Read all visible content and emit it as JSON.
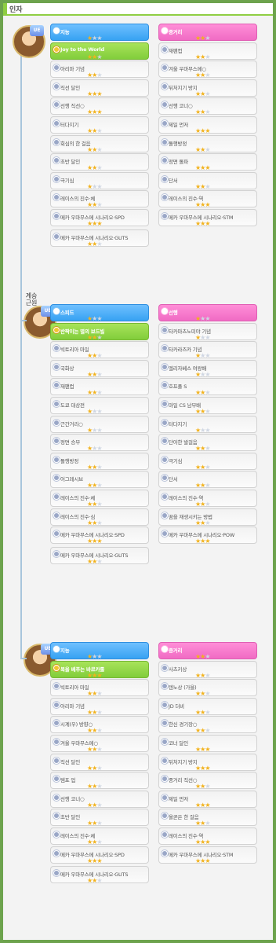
{
  "header": {
    "title": "인자"
  },
  "side_label": "계승\n근원",
  "sections": [
    {
      "badge": "UE",
      "rows": [
        {
          "left": {
            "label": "지능",
            "stars": 1,
            "style": "blue"
          },
          "right": {
            "label": "중거리",
            "stars": 2,
            "style": "pink"
          }
        },
        {
          "left": {
            "label": "Joy to the World",
            "stars": 2,
            "style": "green"
          },
          "right": {
            "label": "재팬컵",
            "stars": 2,
            "style": "white"
          }
        },
        {
          "left": {
            "label": "아리마 기념",
            "stars": 2,
            "style": "white"
          },
          "right": {
            "label": "겨울 우마무스메○",
            "stars": 2,
            "style": "white"
          }
        },
        {
          "left": {
            "label": "직선 달인",
            "stars": 3,
            "style": "white"
          },
          "right": {
            "label": "뒤처지기 방지",
            "stars": 2,
            "style": "white"
          }
        },
        {
          "left": {
            "label": "선행 직선○",
            "stars": 3,
            "style": "white"
          },
          "right": {
            "label": "선행 코너○",
            "stars": 2,
            "style": "white"
          }
        },
        {
          "left": {
            "label": "터다지기",
            "stars": 2,
            "style": "white"
          },
          "right": {
            "label": "제일 먼저",
            "stars": 3,
            "style": "white"
          }
        },
        {
          "left": {
            "label": "회심의 한 걸음",
            "stars": 2,
            "style": "white"
          },
          "right": {
            "label": "돌행방정",
            "stars": 2,
            "style": "white"
          }
        },
        {
          "left": {
            "label": "초반 달인",
            "stars": 2,
            "style": "white"
          },
          "right": {
            "label": "정면 돌파",
            "stars": 3,
            "style": "white"
          }
        },
        {
          "left": {
            "label": "극기심",
            "stars": 1,
            "style": "white"
          },
          "right": {
            "label": "단서",
            "stars": 2,
            "style": "white"
          }
        },
        {
          "left": {
            "label": "레이스의 진수·체",
            "stars": 2,
            "style": "white"
          },
          "right": {
            "label": "레이스의 진수·역",
            "stars": 3,
            "style": "white"
          }
        },
        {
          "left": {
            "label": "메카 우마무스메 시나리오·SPD",
            "stars": 3,
            "style": "white"
          },
          "right": {
            "label": "메카 우마무스메 시나리오·STM",
            "stars": 3,
            "style": "white"
          }
        },
        {
          "left": {
            "label": "메카 우마무스메 시나리오·GUTS",
            "stars": 2,
            "style": "white"
          },
          "right": null
        }
      ]
    },
    {
      "badge": "UE",
      "rows": [
        {
          "left": {
            "label": "스피드",
            "stars": 1,
            "style": "blue"
          },
          "right": {
            "label": "선행",
            "stars": 1,
            "style": "pink"
          }
        },
        {
          "left": {
            "label": "반짝이는 별의 보드빌",
            "stars": 2,
            "style": "green"
          },
          "right": {
            "label": "타카마츠노미야 기념",
            "stars": 1,
            "style": "white"
          }
        },
        {
          "left": {
            "label": "빅토리아 마일",
            "stars": 2,
            "style": "white"
          },
          "right": {
            "label": "타카라즈카 기념",
            "stars": 1,
            "style": "white"
          }
        },
        {
          "left": {
            "label": "국화상",
            "stars": 2,
            "style": "white"
          },
          "right": {
            "label": "엘리자베스 여왕배",
            "stars": 1,
            "style": "white"
          }
        },
        {
          "left": {
            "label": "재팬컵",
            "stars": 2,
            "style": "white"
          },
          "right": {
            "label": "호프풀 S",
            "stars": 2,
            "style": "white"
          }
        },
        {
          "left": {
            "label": "도쿄 대상전",
            "stars": 1,
            "style": "white"
          },
          "right": {
            "label": "마일 CS 남부배",
            "stars": 2,
            "style": "white"
          }
        },
        {
          "left": {
            "label": "근간거리○",
            "stars": 1,
            "style": "white"
          },
          "right": {
            "label": "터다지기",
            "stars": 1,
            "style": "white"
          }
        },
        {
          "left": {
            "label": "정면 승부",
            "stars": 1,
            "style": "white"
          },
          "right": {
            "label": "단아한 발걸음",
            "stars": 2,
            "style": "white"
          }
        },
        {
          "left": {
            "label": "돌행방정",
            "stars": 2,
            "style": "white"
          },
          "right": {
            "label": "극기심",
            "stars": 2,
            "style": "white"
          }
        },
        {
          "left": {
            "label": "어그레시브",
            "stars": 2,
            "style": "white"
          },
          "right": {
            "label": "단서",
            "stars": 2,
            "style": "white"
          }
        },
        {
          "left": {
            "label": "레이스의 진수·체",
            "stars": 2,
            "style": "white"
          },
          "right": {
            "label": "레이스의 진수·역",
            "stars": 2,
            "style": "white"
          }
        },
        {
          "left": {
            "label": "레이스의 진수·심",
            "stars": 2,
            "style": "white"
          },
          "right": {
            "label": "꿈을 재생시키는 방법",
            "stars": 2,
            "style": "white"
          }
        },
        {
          "left": {
            "label": "메카 우마무스메 시나리오·SPD",
            "stars": 3,
            "style": "white"
          },
          "right": {
            "label": "메카 우마무스메 시나리오·POW",
            "stars": 3,
            "style": "white"
          }
        },
        {
          "left": {
            "label": "메카 우마무스메 시나리오·GUTS",
            "stars": 2,
            "style": "white"
          },
          "right": null
        }
      ]
    },
    {
      "badge": "UE",
      "rows": [
        {
          "left": {
            "label": "지능",
            "stars": 1,
            "style": "blue"
          },
          "right": {
            "label": "중거리",
            "stars": 2,
            "style": "pink"
          }
        },
        {
          "left": {
            "label": "복을 베푸는 바르카롤",
            "stars": 3,
            "style": "green"
          },
          "right": {
            "label": "사츠키상",
            "stars": 2,
            "style": "white"
          }
        },
        {
          "left": {
            "label": "빅토리아 마일",
            "stars": 2,
            "style": "white"
          },
          "right": {
            "label": "텐노상 (가을)",
            "stars": 2,
            "style": "white"
          }
        },
        {
          "left": {
            "label": "아리마 기념",
            "stars": 2,
            "style": "white"
          },
          "right": {
            "label": "JD 더비",
            "stars": 2,
            "style": "white"
          }
        },
        {
          "left": {
            "label": "시계(우) 방향○",
            "stars": 2,
            "style": "white"
          },
          "right": {
            "label": "한신 경기장○",
            "stars": 2,
            "style": "white"
          }
        },
        {
          "left": {
            "label": "겨울 우마무스메○",
            "stars": 2,
            "style": "white"
          },
          "right": {
            "label": "코너 달인",
            "stars": 3,
            "style": "white"
          }
        },
        {
          "left": {
            "label": "직선 달인",
            "stars": 2,
            "style": "white"
          },
          "right": {
            "label": "뒤처지기 방지",
            "stars": 3,
            "style": "white"
          }
        },
        {
          "left": {
            "label": "템포 업",
            "stars": 2,
            "style": "white"
          },
          "right": {
            "label": "중거리 직선○",
            "stars": 2,
            "style": "white"
          }
        },
        {
          "left": {
            "label": "선행 코너○",
            "stars": 2,
            "style": "white"
          },
          "right": {
            "label": "제일 먼저",
            "stars": 3,
            "style": "white"
          }
        },
        {
          "left": {
            "label": "초반 달인",
            "stars": 2,
            "style": "white"
          },
          "right": {
            "label": "올곧은 한 걸음",
            "stars": 2,
            "style": "white"
          }
        },
        {
          "left": {
            "label": "레이스의 진수·체",
            "stars": 2,
            "style": "white"
          },
          "right": {
            "label": "레이스의 진수·역",
            "stars": 3,
            "style": "white"
          }
        },
        {
          "left": {
            "label": "메카 우마무스메 시나리오·SPD",
            "stars": 3,
            "style": "white"
          },
          "right": {
            "label": "메카 우마무스메 시나리오·STM",
            "stars": 3,
            "style": "white"
          }
        },
        {
          "left": {
            "label": "메카 우마무스메 시나리오·GUTS",
            "stars": 2,
            "style": "white"
          },
          "right": null
        }
      ]
    }
  ],
  "colors": {
    "blue": "#37a2f2",
    "pink": "#f06bc4",
    "green": "#81cd3b",
    "star_on": "#f2b21c",
    "star_off": "#cfd6e2",
    "background": "#6da34d"
  }
}
